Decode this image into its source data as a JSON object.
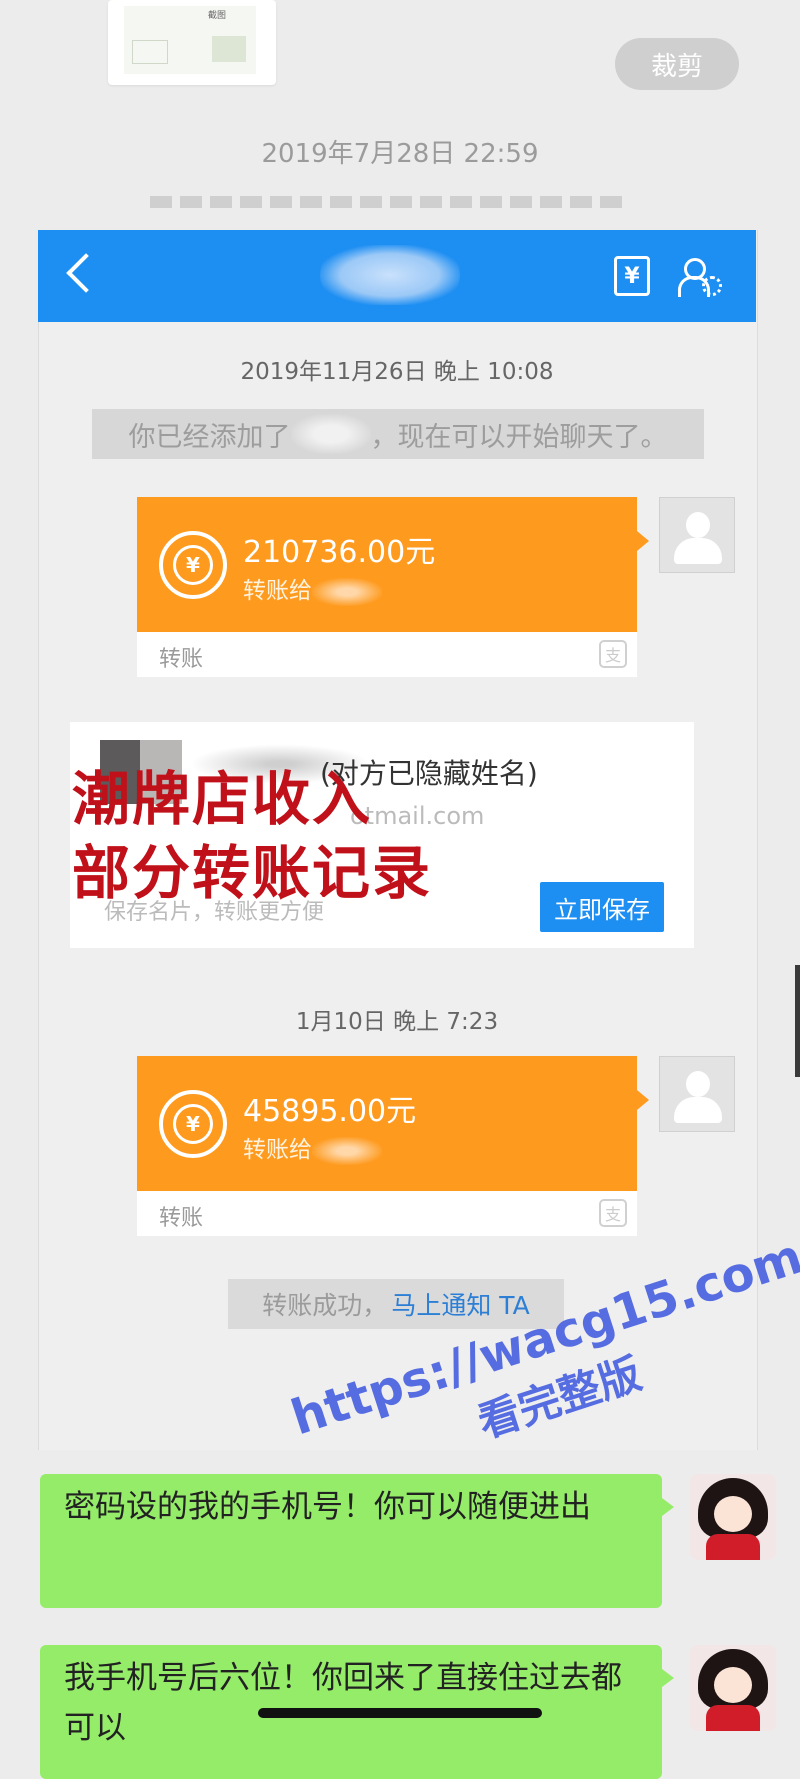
{
  "outer": {
    "crop_button": "裁剪",
    "timestamp": "2019年7月28日 22:59",
    "thumbnail_text": "截图"
  },
  "header": {
    "back_icon": "chevron-left-icon",
    "bill_icon": "yen-bill-icon",
    "settings_icon": "user-settings-icon"
  },
  "chat": {
    "time1": "2019年11月26日 晚上 10:08",
    "added_prefix": "你已经添加了",
    "added_suffix": "，现在可以开始聊天了。",
    "transfer1": {
      "amount": "210736.00元",
      "to": "转账给",
      "label": "转账"
    },
    "card": {
      "hidden_name": "(对方已隐藏姓名)",
      "email_suffix": "otmail.com",
      "save_hint": "保存名片，转账更方便",
      "save_button": "立即保存"
    },
    "overlay_line1": "潮牌店收入",
    "overlay_line2": "部分转账记录",
    "time2": "1月10日 晚上 7:23",
    "transfer2": {
      "amount": "45895.00元",
      "to": "转账给",
      "label": "转账"
    },
    "success_text": "转账成功，",
    "notify_link": "马上通知 TA"
  },
  "messages": [
    {
      "text": "密码设的我的手机号！你可以随便进出"
    },
    {
      "text": "我手机号后六位！你回来了直接住过去都可以"
    }
  ],
  "watermark": {
    "url": "https://wacg15.com",
    "sub": "看完整版"
  },
  "colors": {
    "header_blue": "#1d8ef2",
    "transfer_orange": "#fe9a1e",
    "bubble_green": "#95ec69",
    "overlay_red": "#c0101a"
  }
}
